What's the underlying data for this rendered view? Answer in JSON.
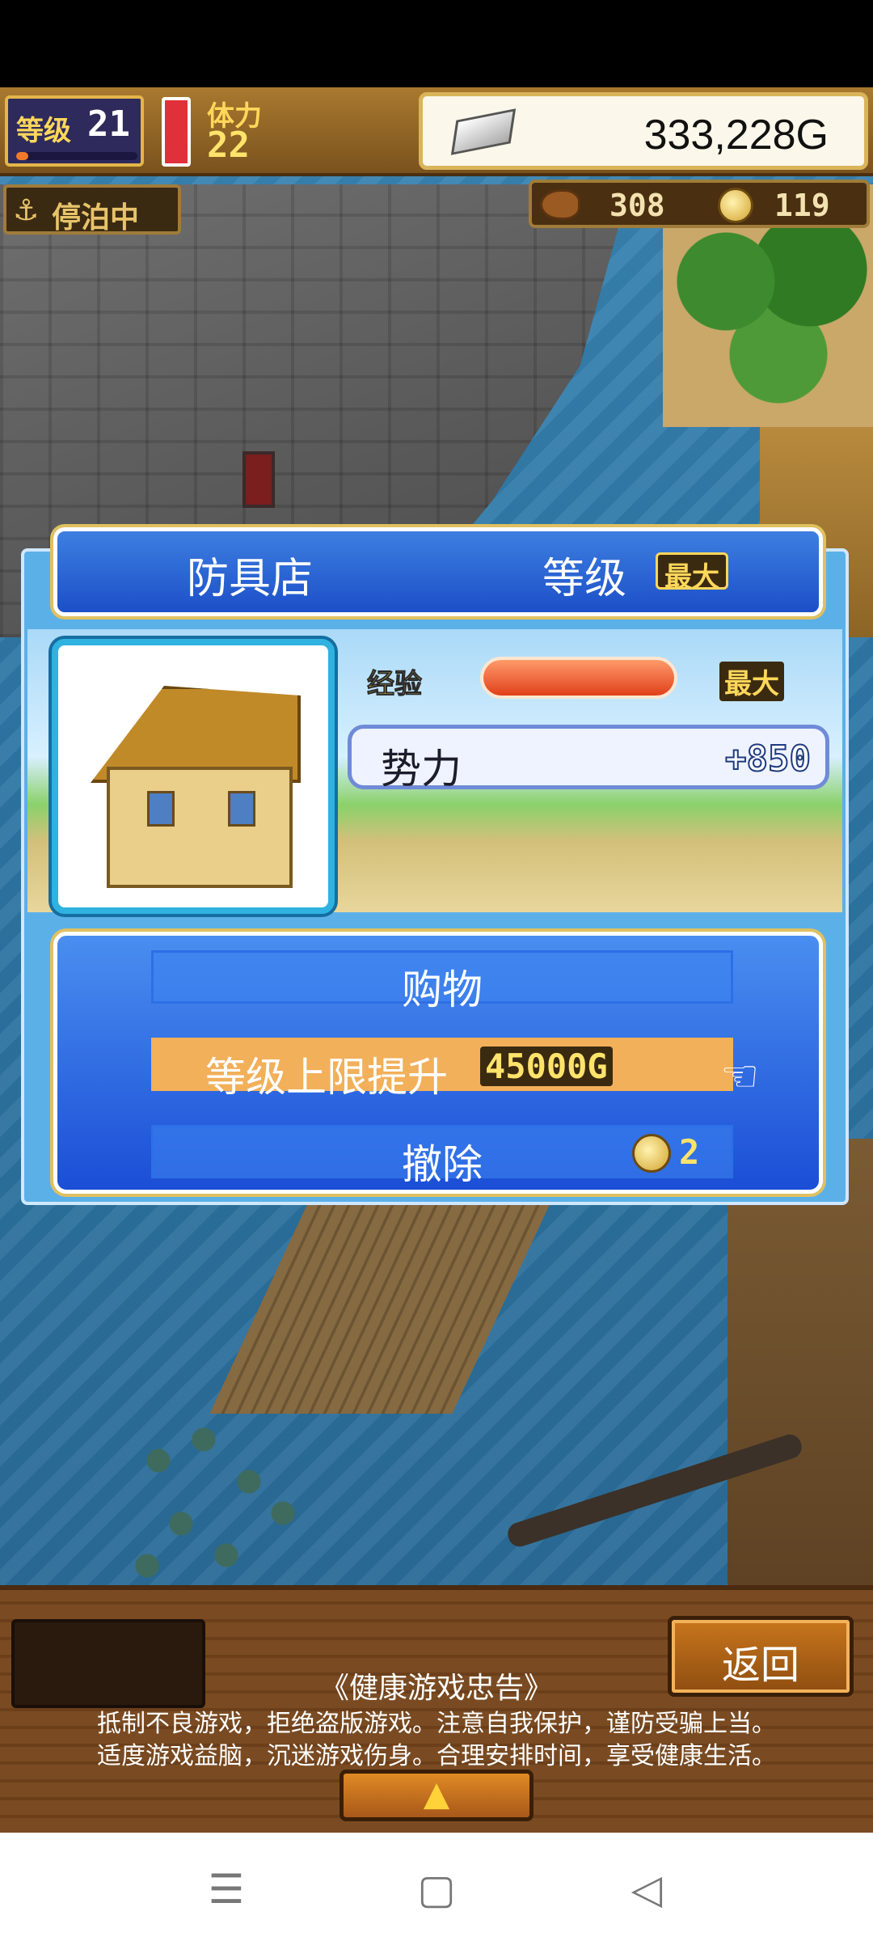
{
  "hud": {
    "level_label": "等级",
    "level_value": "21",
    "stamina_label": "体力",
    "stamina_value": "22",
    "money": "333,228G"
  },
  "status": {
    "docked_label": "停泊中",
    "food": "308",
    "coins": "119"
  },
  "dialog": {
    "shop_name": "防具店",
    "level_title": "等级",
    "level_badge": "最大",
    "exp_label": "经验",
    "exp_max": "最大",
    "exp_progress": 1.0,
    "power_label": "势力",
    "power_value": "+850",
    "menu": {
      "shop": "购物",
      "upgrade_label": "等级上限提升",
      "upgrade_cost": "45000G",
      "remove": "撤除",
      "remove_cost": "2"
    }
  },
  "bottom": {
    "back": "返回",
    "notice_title": "《健康游戏忠告》",
    "notice_line1": "抵制不良游戏，拒绝盗版游戏。注意自我保护，谨防受骗上当。",
    "notice_line2": "适度游戏益脑，沉迷游戏伤身。合理安排时间，享受健康生活。",
    "expand_icon": "▲"
  },
  "nav": {
    "menu_icon": "☰",
    "home_icon": "▢",
    "back_icon": "◁"
  },
  "colors": {
    "dialog_blue": "#1b4ed6",
    "hud_brown": "#7a521d",
    "selection": "#f2b05a"
  }
}
